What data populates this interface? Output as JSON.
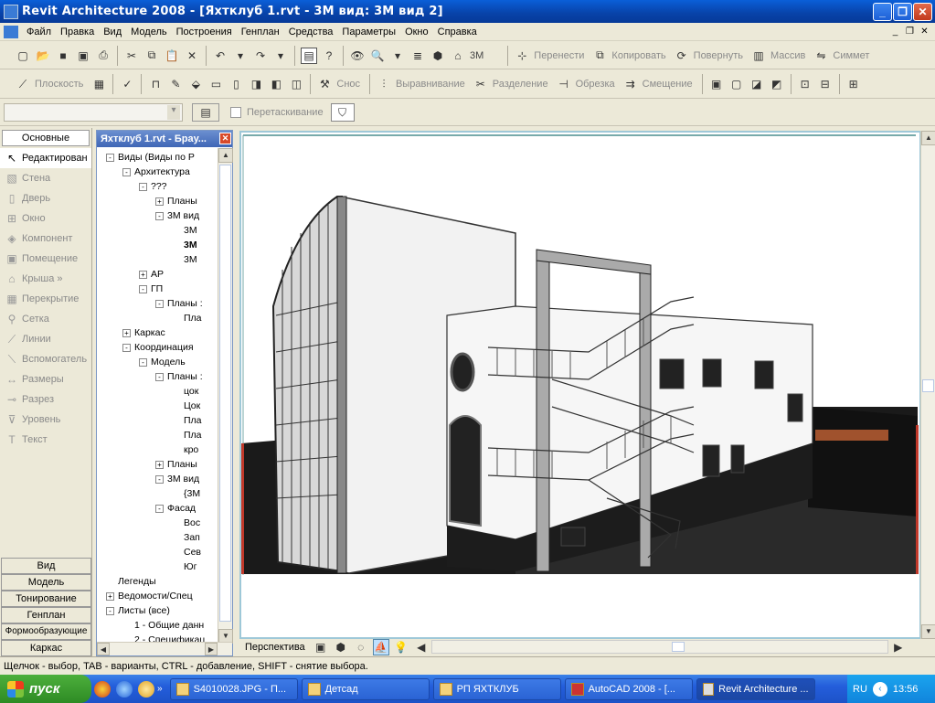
{
  "window": {
    "title": "Revit Architecture 2008 - [Яхтклуб 1.rvt - 3М вид: 3М вид 2]",
    "min_label": "_",
    "max_label": "❐",
    "close_label": "✕"
  },
  "menu": [
    "Файл",
    "Правка",
    "Вид",
    "Модель",
    "Построения",
    "Генплан",
    "Средства",
    "Параметры",
    "Окно",
    "Справка"
  ],
  "toolbar1": {
    "view3d_label": "3М",
    "move_label": "Перенести",
    "copy_label": "Копировать",
    "rotate_label": "Повернуть",
    "array_label": "Массив",
    "mirror_label": "Симмет"
  },
  "toolbar2": {
    "plane_label": "Плоскость",
    "demolish_label": "Снос",
    "align_label": "Выравнивание",
    "split_label": "Разделение",
    "trim_label": "Обрезка",
    "offset_label": "Смещение"
  },
  "toolbar3": {
    "drag_label": "Перетаскивание"
  },
  "left": {
    "tab": "Основные",
    "tools": [
      "Редактирован",
      "Стена",
      "Дверь",
      "Окно",
      "Компонент",
      "Помещение",
      "Крыша »",
      "Перекрытие",
      "Сетка",
      "Линии",
      "Вспомогатель",
      "Размеры",
      "Разрез",
      "Уровень",
      "Текст"
    ],
    "bottom_tabs": [
      "Вид",
      "Модель",
      "Тонирование",
      "Генплан",
      "Формообразующие",
      "Каркас"
    ]
  },
  "browser": {
    "title": "Яхтклуб 1.rvt - Брау...",
    "nodes": [
      {
        "label": "Виды (Виды по Р",
        "depth": 0,
        "pm": "-"
      },
      {
        "label": "Архитектура",
        "depth": 1,
        "pm": "-"
      },
      {
        "label": "???",
        "depth": 2,
        "pm": "-"
      },
      {
        "label": "Планы",
        "depth": 3,
        "pm": "+"
      },
      {
        "label": "3М вид",
        "depth": 3,
        "pm": "-"
      },
      {
        "label": "3М",
        "depth": 4,
        "pm": ""
      },
      {
        "label": "3М",
        "depth": 4,
        "pm": "",
        "bold": true
      },
      {
        "label": "3М",
        "depth": 4,
        "pm": ""
      },
      {
        "label": "АР",
        "depth": 2,
        "pm": "+"
      },
      {
        "label": "ГП",
        "depth": 2,
        "pm": "-"
      },
      {
        "label": "Планы :",
        "depth": 3,
        "pm": "-"
      },
      {
        "label": "Пла",
        "depth": 4,
        "pm": ""
      },
      {
        "label": "Каркас",
        "depth": 1,
        "pm": "+"
      },
      {
        "label": "Координация",
        "depth": 1,
        "pm": "-"
      },
      {
        "label": "Модель",
        "depth": 2,
        "pm": "-"
      },
      {
        "label": "Планы :",
        "depth": 3,
        "pm": "-"
      },
      {
        "label": "цок",
        "depth": 4,
        "pm": ""
      },
      {
        "label": "Цок",
        "depth": 4,
        "pm": ""
      },
      {
        "label": "Пла",
        "depth": 4,
        "pm": ""
      },
      {
        "label": "Пла",
        "depth": 4,
        "pm": ""
      },
      {
        "label": "кро",
        "depth": 4,
        "pm": ""
      },
      {
        "label": "Планы",
        "depth": 3,
        "pm": "+"
      },
      {
        "label": "3М вид",
        "depth": 3,
        "pm": "-"
      },
      {
        "label": "{3М",
        "depth": 4,
        "pm": ""
      },
      {
        "label": "Фасад",
        "depth": 3,
        "pm": "-"
      },
      {
        "label": "Вос",
        "depth": 4,
        "pm": ""
      },
      {
        "label": "Зап",
        "depth": 4,
        "pm": ""
      },
      {
        "label": "Сев",
        "depth": 4,
        "pm": ""
      },
      {
        "label": "Юг",
        "depth": 4,
        "pm": ""
      },
      {
        "label": "Легенды",
        "depth": 0,
        "pm": ""
      },
      {
        "label": "Ведомости/Спец",
        "depth": 0,
        "pm": "+"
      },
      {
        "label": "Листы (все)",
        "depth": 0,
        "pm": "-"
      },
      {
        "label": "1 - Общие данн",
        "depth": 1,
        "pm": ""
      },
      {
        "label": "2 - Спецификац",
        "depth": 1,
        "pm": ""
      }
    ]
  },
  "viewbar": {
    "label": "Перспектива"
  },
  "status": "Щелчок - выбор, TAB - варианты, CTRL - добавление, SHIFT - снятие выбора.",
  "taskbar": {
    "start": "пуск",
    "tasks": [
      "S4010028.JPG - П...",
      "Детсад",
      "РП ЯХТКЛУБ",
      "AutoCAD 2008 - [...",
      "Revit Architecture ..."
    ],
    "lang": "RU",
    "time": "13:56"
  }
}
